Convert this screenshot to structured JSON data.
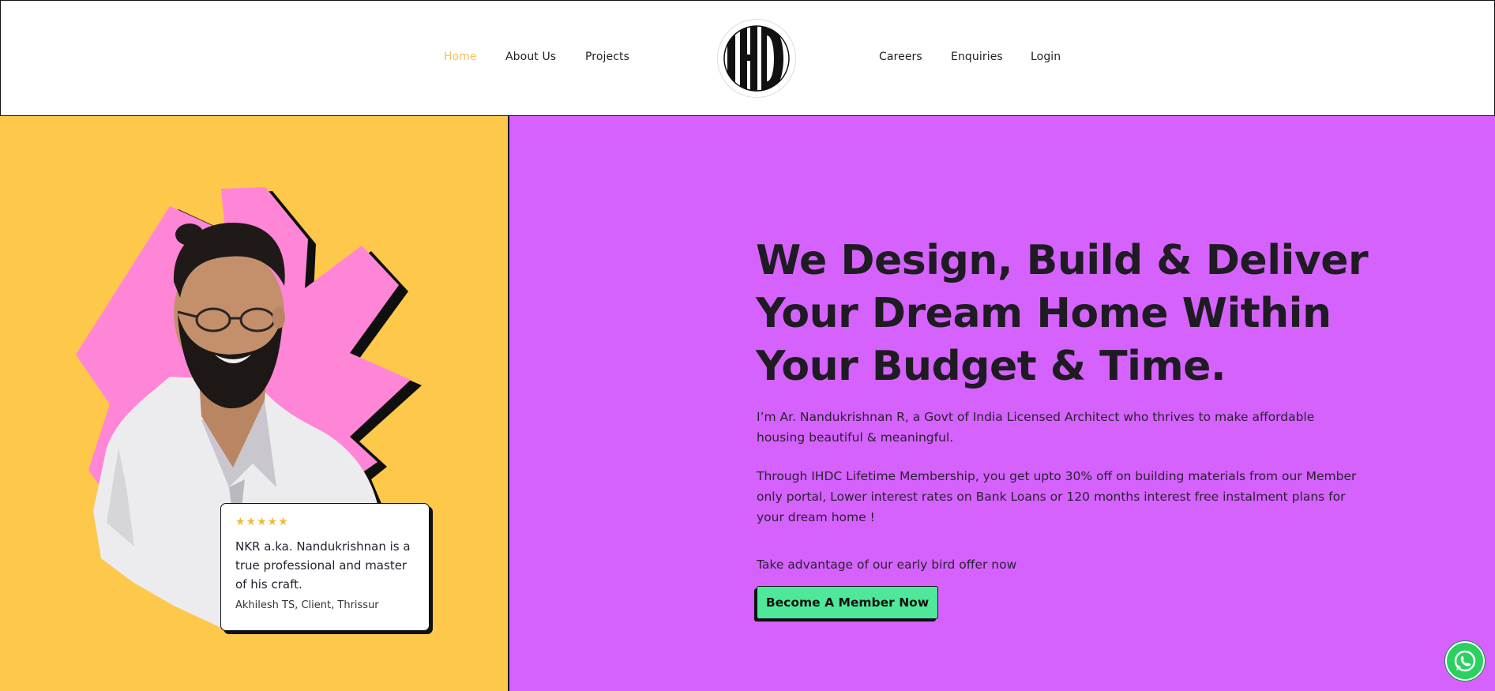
{
  "nav": {
    "left_links": [
      "Home",
      "About Us",
      "Projects"
    ],
    "right_links": [
      "Careers",
      "Enquiries",
      "Login"
    ],
    "active": "Home",
    "logo_text": "IHDC"
  },
  "hero": {
    "headline_lines": [
      "We Design, Build & Deliver",
      "Your Dream Home Within",
      "Your Budget & Time."
    ],
    "intro": "I’m Ar. Nandukrishnan R, a Govt of India Licensed Architect who thrives to make affordable housing beautiful & meaningful.",
    "membership": "Through IHDC Lifetime Membership, you get upto 30% off on building materials from our Member only portal, Lower interest rates on Bank Loans or 120 months interest free instalment plans for your dream home !",
    "offer": "Take advantage of our early bird offer now",
    "cta_label": "Become A Member Now"
  },
  "testimonial": {
    "stars": "★★★★★",
    "rating": 5,
    "quote": "NKR a.ka. Nandukrishnan is a true professional and master of his craft.",
    "author": "Akhilesh TS, Client, Thrissur"
  },
  "colors": {
    "yellow": "#fec84a",
    "purple": "#d562fd",
    "pink": "#ff86d6",
    "green": "#4fe89a",
    "active_link": "#f4c15a",
    "whatsapp": "#2bd061"
  },
  "icons": {
    "whatsapp": "whatsapp-icon",
    "star": "star-icon"
  }
}
